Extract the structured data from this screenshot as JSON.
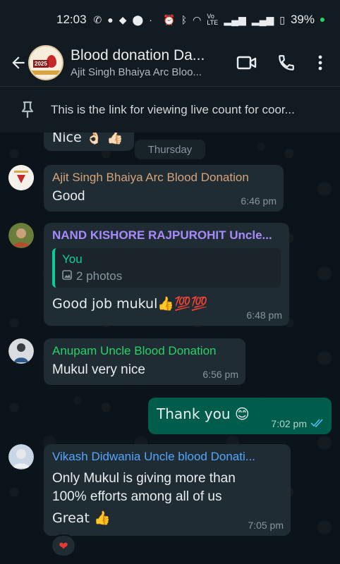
{
  "status_bar": {
    "time": "12:03",
    "network_label": "Vo LTE",
    "battery": "39%"
  },
  "header": {
    "group_name": "Blood donation Da...",
    "subtitle": "Ajit Singh Bhaiya Arc Bloo...",
    "avatar_year": "2025",
    "icons": [
      "back-arrow-icon",
      "video-call-icon",
      "phone-icon",
      "more-vert-icon"
    ]
  },
  "pinned": {
    "text": "This is the link for viewing live count for coor..."
  },
  "chat": {
    "partial_top_message": "Nice 👌🏻 👍🏻",
    "date_pill": "Thursday",
    "messages": [
      {
        "sender": "Ajit Singh Bhaiya Arc Blood Donation",
        "sender_color": "#d6a37a",
        "text": "Good",
        "time": "6:46 pm"
      },
      {
        "sender": "NAND KISHORE RAJPUROHIT Uncle...",
        "sender_color": "#a78bfa",
        "quote": {
          "name": "You",
          "body": "2 photos"
        },
        "text": "Good job mukul👍💯💯",
        "time": "6:48 pm"
      },
      {
        "sender": "Anupam Uncle Blood Donation",
        "sender_color": "#53bdeb",
        "text": "Mukul very nice",
        "time": "6:56 pm"
      },
      {
        "outgoing": true,
        "text": "Thank you 😊",
        "time": "7:02 pm"
      },
      {
        "sender": "Vikash Didwania Uncle blood Donati...",
        "sender_color": "#53a6fd",
        "lines": [
          "Only Mukul is giving more than",
          "100% efforts among all of us",
          "Great 👍"
        ],
        "time": "7:05 pm",
        "reaction": "❤"
      }
    ]
  },
  "colors": {
    "background": "#0b141a",
    "bubble_in": "#202c33",
    "bubble_out": "#005c4b",
    "accent": "#06cf9c",
    "read_ticks": "#53bdeb"
  }
}
